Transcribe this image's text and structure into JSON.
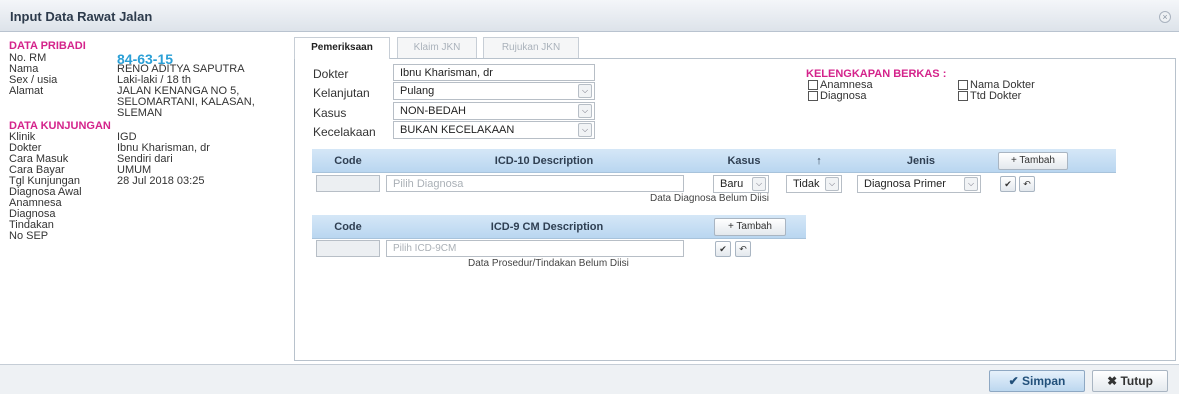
{
  "window": {
    "title": "Input Data Rawat Jalan",
    "close_icon": "×"
  },
  "left": {
    "section_pribadi": "DATA PRIBADI",
    "no_rm_label": "No. RM",
    "no_rm": "84-63-15",
    "nama_label": "Nama",
    "nama": "RENO ADITYA SAPUTRA",
    "sex_label": "Sex / usia",
    "sex": "Laki-laki / 18 th",
    "alamat_label": "Alamat",
    "alamat1": "JALAN KENANGA NO 5,",
    "alamat2": "SELOMARTANI, KALASAN,",
    "alamat3": "SLEMAN",
    "section_kunjungan": "DATA KUNJUNGAN",
    "klinik_label": "Klinik",
    "klinik": "IGD",
    "dokter_label": "Dokter",
    "dokter": "Ibnu Kharisman, dr",
    "cara_masuk_label": "Cara Masuk",
    "cara_masuk": "Sendiri dari",
    "cara_bayar_label": "Cara Bayar",
    "cara_bayar": "UMUM",
    "tgl_label": "Tgl Kunjungan",
    "tgl": "28 Jul 2018 03:25",
    "diag_awal_label": "Diagnosa Awal",
    "anamnesa_label": "Anamnesa",
    "diagnosa_label": "Diagnosa",
    "tindakan_label": "Tindakan",
    "nosep_label": "No SEP"
  },
  "tabs": [
    "Pemeriksaan",
    "Klaim JKN",
    "Rujukan JKN"
  ],
  "form": {
    "dokter_label": "Dokter",
    "dokter_value": "Ibnu Kharisman, dr",
    "kelanjutan_label": "Kelanjutan",
    "kelanjutan_value": "Pulang",
    "kasus_label": "Kasus",
    "kasus_value": "NON-BEDAH",
    "kecelakaan_label": "Kecelakaan",
    "kecelakaan_value": "BUKAN KECELAKAAN"
  },
  "kelengkapan": {
    "title": "KELENGKAPAN BERKAS :",
    "anamnesa": "Anamnesa",
    "nama_dokter": "Nama Dokter",
    "diagnosa": "Diagnosa",
    "ttd_dokter": "Ttd Dokter"
  },
  "icd10": {
    "col_code": "Code",
    "col_desc": "ICD-10 Description",
    "col_kasus": "Kasus",
    "col_arrow": "↑",
    "col_jenis": "Jenis",
    "tambah": "+ Tambah",
    "placeholder": "Pilih Diagnosa",
    "kasus_value": "Baru",
    "tidak_value": "Tidak",
    "jenis_value": "Diagnosa Primer",
    "empty": "Data Diagnosa Belum Diisi"
  },
  "icd9": {
    "col_code": "Code",
    "col_desc": "ICD-9 CM Description",
    "tambah": "+ Tambah",
    "placeholder": "Pilih ICD-9CM",
    "empty": "Data Prosedur/Tindakan Belum Diisi"
  },
  "icons": {
    "dropdown": "⌵",
    "check": "✔",
    "undo": "↶"
  },
  "footer": {
    "simpan": "✔  Simpan",
    "tutup": "✖  Tutup"
  }
}
